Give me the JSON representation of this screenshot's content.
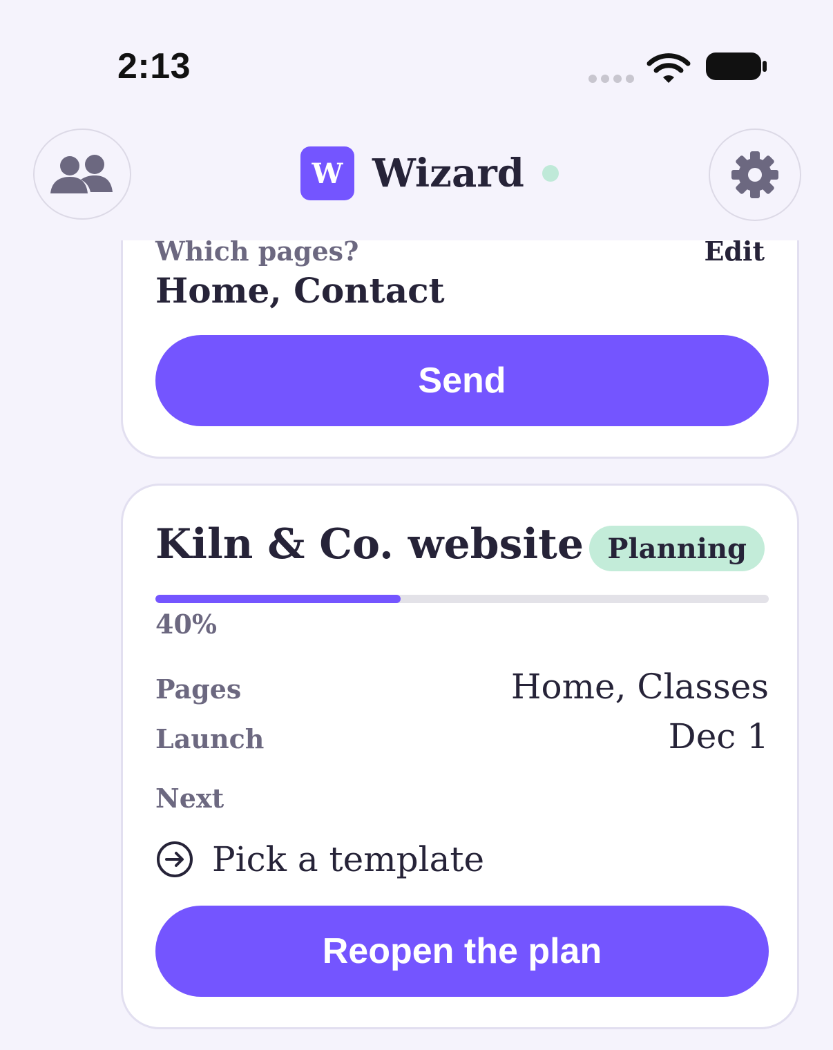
{
  "status_bar": {
    "time": "2:13"
  },
  "header": {
    "logo_letter": "W",
    "app_name": "Wizard"
  },
  "request_card": {
    "question": "Which pages?",
    "edit_label": "Edit",
    "answer": "Home, Contact",
    "send_label": "Send"
  },
  "project_card": {
    "title": "Kiln & Co. website",
    "status": "Planning",
    "progress_percent": 40,
    "progress_label": "40%",
    "pages_label": "Pages",
    "pages_value": "Home, Classes",
    "launch_label": "Launch",
    "launch_value": "Dec 1",
    "next_label": "Next",
    "next_step": "Pick a template",
    "reopen_label": "Reopen the plan"
  },
  "colors": {
    "accent": "#7455ff",
    "background": "#f5f3fc",
    "status_badge": "#c3ecd9",
    "online_dot": "#bfe9d8"
  },
  "icons": [
    "wifi-icon",
    "battery-icon",
    "people-icon",
    "gear-icon",
    "arrow-circle-right-icon"
  ]
}
